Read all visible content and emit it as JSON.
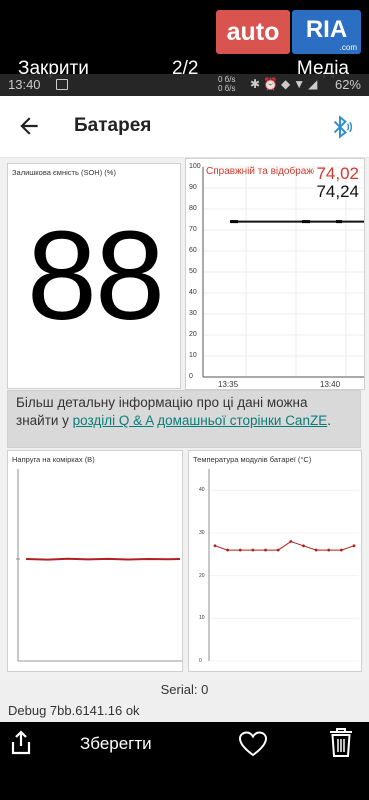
{
  "viewer": {
    "close_label": "Закрити",
    "page_counter": "2/2",
    "media_label": "Медіа",
    "brand_left": "auto",
    "brand_right": "RIA",
    "brand_sub": ".com"
  },
  "statusbar": {
    "time": "13:40",
    "speed_up": "0 б/s",
    "speed_down": "0 б/s",
    "battery": "62%"
  },
  "app": {
    "title": "Батарея"
  },
  "soh": {
    "title": "Залишкова ємність (SOH) (%)",
    "value": "88"
  },
  "real": {
    "title": "Справжній та відображений",
    "value_red": "74,02",
    "value_black": "74,24",
    "yticks": [
      "100",
      "90",
      "80",
      "70",
      "60",
      "50",
      "40",
      "30",
      "20",
      "10",
      "0"
    ],
    "xticks": [
      "13:35",
      "13:40"
    ]
  },
  "info": {
    "text_before": "Більш детальну інформацію про ці дані можна знайти у ",
    "link1": "розділі Q & A",
    "link2": "домашньої сторінки CanZE",
    "text_after": "."
  },
  "volt": {
    "title": "Напруга на комірках (В)"
  },
  "temp": {
    "title": "Температура модулів батареї (°C)",
    "yticks": [
      "40",
      "30",
      "20",
      "10",
      "0"
    ]
  },
  "footer": {
    "serial": "Serial: 0",
    "debug": "Debug 7bb.6141.16 ok",
    "save_label": "Зберегти"
  },
  "chart_data": [
    {
      "type": "line",
      "title": "Справжній та відображений",
      "x": [
        "13:35",
        "13:40"
      ],
      "series": [
        {
          "name": "",
          "values": [
            74.0,
            74.0
          ]
        }
      ],
      "ylim": [
        0,
        100
      ],
      "last_values": [
        "74,02",
        "74,24"
      ]
    },
    {
      "type": "line",
      "title": "Температура модулів батареї (°C)",
      "series": [
        {
          "name": "",
          "values": [
            27,
            26,
            26,
            26,
            26,
            26,
            28,
            27,
            26,
            26,
            26,
            27
          ]
        }
      ],
      "ylim": [
        0,
        45
      ]
    }
  ]
}
